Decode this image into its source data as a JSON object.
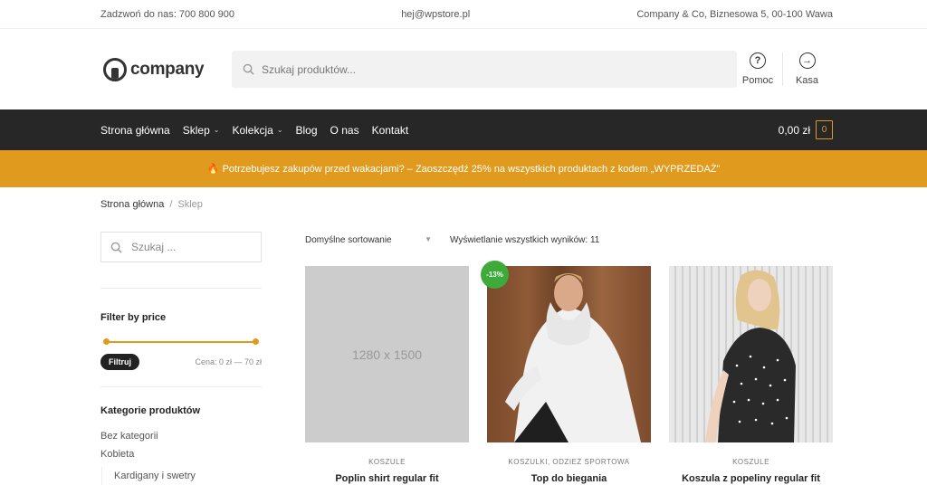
{
  "topbar": {
    "phone": "Zadzwoń do nas: 700 800 900",
    "email": "hej@wpstore.pl",
    "address": "Company & Co, Biznesowa 5, 00-100 Wawa"
  },
  "header": {
    "logo_text": "company",
    "search_placeholder": "Szukaj produktów...",
    "help_label": "Pomoc",
    "checkout_label": "Kasa"
  },
  "nav": {
    "items": [
      {
        "label": "Strona główna"
      },
      {
        "label": "Sklep"
      },
      {
        "label": "Kolekcja"
      },
      {
        "label": "Blog"
      },
      {
        "label": "O nas"
      },
      {
        "label": "Kontakt"
      }
    ],
    "cart_total": "0,00 zł",
    "cart_count": "0"
  },
  "promo": {
    "text": "🔥 Potrzebujesz zakupów przed wakacjami? – Zaoszczędź 25% na wszystkich produktach z kodem „WYPRZEDAŻ”"
  },
  "breadcrumb": {
    "home": "Strona główna",
    "separator": "/",
    "current": "Sklep"
  },
  "sidebar": {
    "search_placeholder": "Szukaj ...",
    "filter_title": "Filter by price",
    "filter_button": "Filtruj",
    "price_range": "Cena: 0 zł — 70 zł",
    "categories_title": "Kategorie produktów",
    "categories": [
      "Bez kategorii",
      "Kobieta"
    ],
    "subcategories": [
      "Kardigany i swetry"
    ]
  },
  "shop": {
    "sort_value": "Domyślne sortowanie",
    "result_count": "Wyświetlanie wszystkich wyników: 11",
    "products": [
      {
        "category": "KOSZULE",
        "name": "Poplin shirt regular fit",
        "image": "1280 x 1500",
        "badge": ""
      },
      {
        "category": "KOSZULKI, ODZIEŻ SPORTOWA",
        "name": "Top do biegania",
        "image": "",
        "badge": "-13%"
      },
      {
        "category": "KOSZULE",
        "name": "Koszula z popeliny regular fit",
        "image": "",
        "badge": ""
      }
    ]
  },
  "colors": {
    "accent": "#e09a1d",
    "nav_bg": "#272727",
    "sale_badge": "#3daa3a"
  }
}
